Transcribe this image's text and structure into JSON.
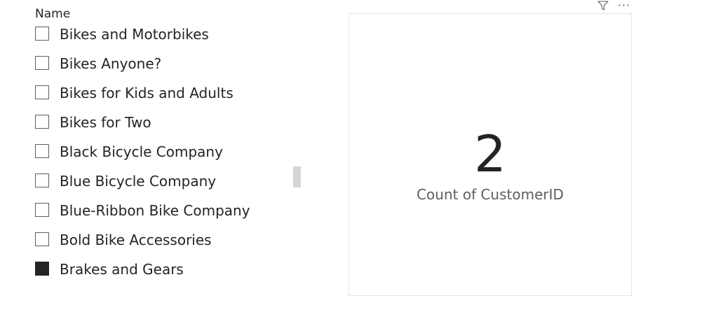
{
  "slicer": {
    "header": "Name",
    "items": [
      {
        "label": "Bikes and Motorbikes",
        "checked": false
      },
      {
        "label": "Bikes Anyone?",
        "checked": false
      },
      {
        "label": "Bikes for Kids and Adults",
        "checked": false
      },
      {
        "label": "Bikes for Two",
        "checked": false
      },
      {
        "label": "Black Bicycle Company",
        "checked": false
      },
      {
        "label": "Blue Bicycle Company",
        "checked": false
      },
      {
        "label": "Blue-Ribbon Bike Company",
        "checked": false
      },
      {
        "label": "Bold Bike Accessories",
        "checked": false
      },
      {
        "label": "Brakes and Gears",
        "checked": true
      }
    ]
  },
  "card": {
    "value": "2",
    "label": "Count of CustomerID"
  },
  "visual_header": {
    "filter_icon": "filter-icon",
    "more_options_icon": "more-options-icon",
    "more_options_glyph": "···"
  },
  "colors": {
    "text": "#252423",
    "secondary_text": "#605e5c",
    "checked_fill": "#252423",
    "border": "#e4e4e4"
  }
}
